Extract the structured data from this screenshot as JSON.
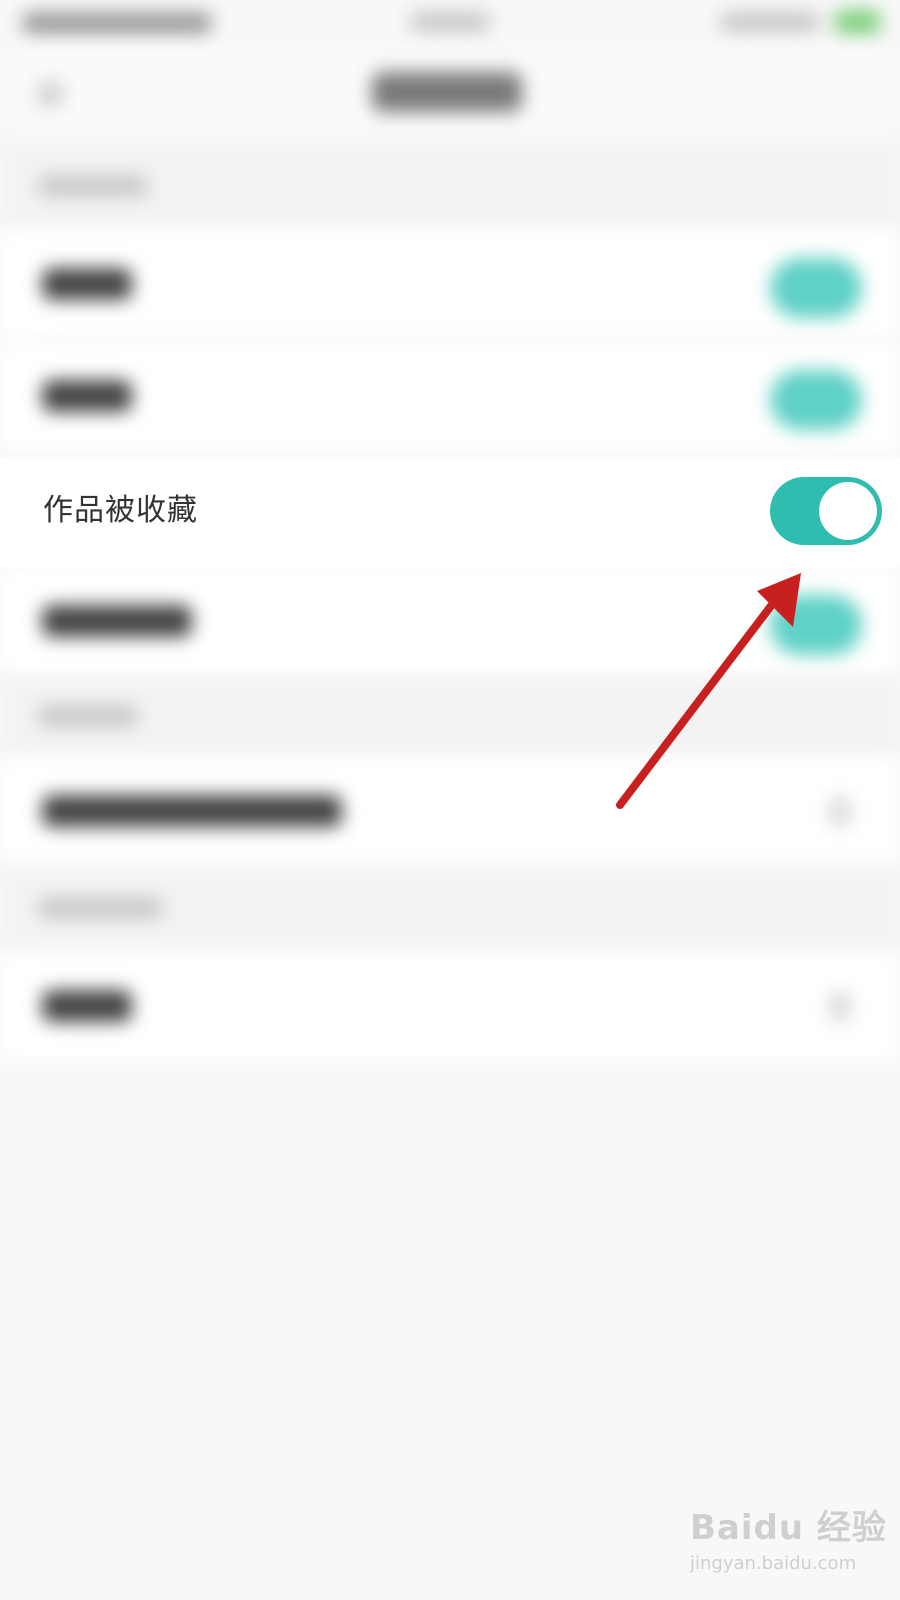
{
  "setting": {
    "label": "作品被收藏",
    "enabled": true
  },
  "colors": {
    "toggle_on": "#2ebdaf",
    "annotation_arrow": "#c8201e"
  },
  "watermark": {
    "logo": "Baidu 经验",
    "url": "jingyan.baidu.com"
  }
}
